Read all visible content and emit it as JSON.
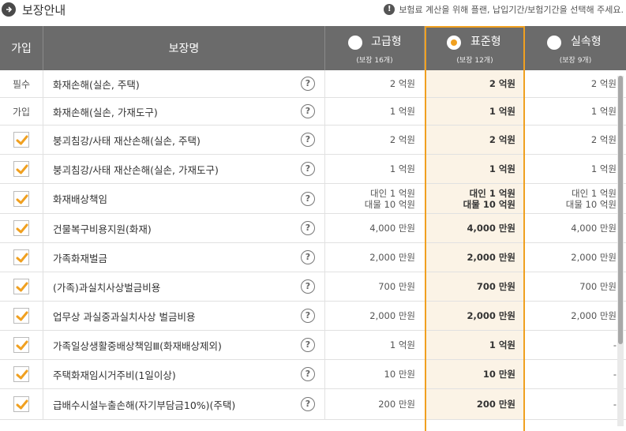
{
  "header": {
    "title": "보장안내",
    "notice": "보험료 계산을 위해 플랜, 납입기간/보험기간을 선택해 주세요."
  },
  "table": {
    "col_join": "가입",
    "col_name": "보장명",
    "plans": [
      {
        "name": "고급형",
        "count": "(보장 16개)",
        "selected": false
      },
      {
        "name": "표준형",
        "count": "(보장 12개)",
        "selected": true
      },
      {
        "name": "실속형",
        "count": "(보장 9개)",
        "selected": false
      }
    ],
    "rows": [
      {
        "join": "필수",
        "name": "화재손해(실손, 주택)",
        "v1": [
          "2 억원"
        ],
        "v2": [
          "2 억원"
        ],
        "v3": [
          "2 억원"
        ]
      },
      {
        "join": "가입",
        "name": "화재손해(실손, 가재도구)",
        "v1": [
          "1 억원"
        ],
        "v2": [
          "1 억원"
        ],
        "v3": [
          "1 억원"
        ]
      },
      {
        "join": "check",
        "name": "붕괴침강/사태 재산손해(실손, 주택)",
        "v1": [
          "2 억원"
        ],
        "v2": [
          "2 억원"
        ],
        "v3": [
          "2 억원"
        ]
      },
      {
        "join": "check",
        "name": "붕괴침강/사태 재산손해(실손, 가재도구)",
        "v1": [
          "1 억원"
        ],
        "v2": [
          "1 억원"
        ],
        "v3": [
          "1 억원"
        ]
      },
      {
        "join": "check",
        "name": "화재배상책임",
        "v1": [
          "대인 1 억원",
          "대물 10 억원"
        ],
        "v2": [
          "대인 1 억원",
          "대물 10 억원"
        ],
        "v3": [
          "대인 1 억원",
          "대물 10 억원"
        ]
      },
      {
        "join": "check",
        "name": "건물복구비용지원(화재)",
        "v1": [
          "4,000 만원"
        ],
        "v2": [
          "4,000 만원"
        ],
        "v3": [
          "4,000 만원"
        ]
      },
      {
        "join": "check",
        "name": "가족화재벌금",
        "v1": [
          "2,000 만원"
        ],
        "v2": [
          "2,000 만원"
        ],
        "v3": [
          "2,000 만원"
        ]
      },
      {
        "join": "check",
        "name": "(가족)과실치사상벌금비용",
        "v1": [
          "700 만원"
        ],
        "v2": [
          "700 만원"
        ],
        "v3": [
          "700 만원"
        ]
      },
      {
        "join": "check",
        "name": "업무상 과실중과실치사상 벌금비용",
        "v1": [
          "2,000 만원"
        ],
        "v2": [
          "2,000 만원"
        ],
        "v3": [
          "2,000 만원"
        ]
      },
      {
        "join": "check",
        "name": "가족일상생활중배상책임Ⅲ(화재배상제외)",
        "v1": [
          "1 억원"
        ],
        "v2": [
          "1 억원"
        ],
        "v3": [
          "-"
        ]
      },
      {
        "join": "check",
        "name": "주택화재임시거주비(1일이상)",
        "v1": [
          "10 만원"
        ],
        "v2": [
          "10 만원"
        ],
        "v3": [
          "-"
        ]
      },
      {
        "join": "check",
        "name": "급배수시설누출손해(자기부담금10%)(주택)",
        "v1": [
          "200 만원"
        ],
        "v2": [
          "200 만원"
        ],
        "v3": [
          "-"
        ]
      }
    ]
  }
}
